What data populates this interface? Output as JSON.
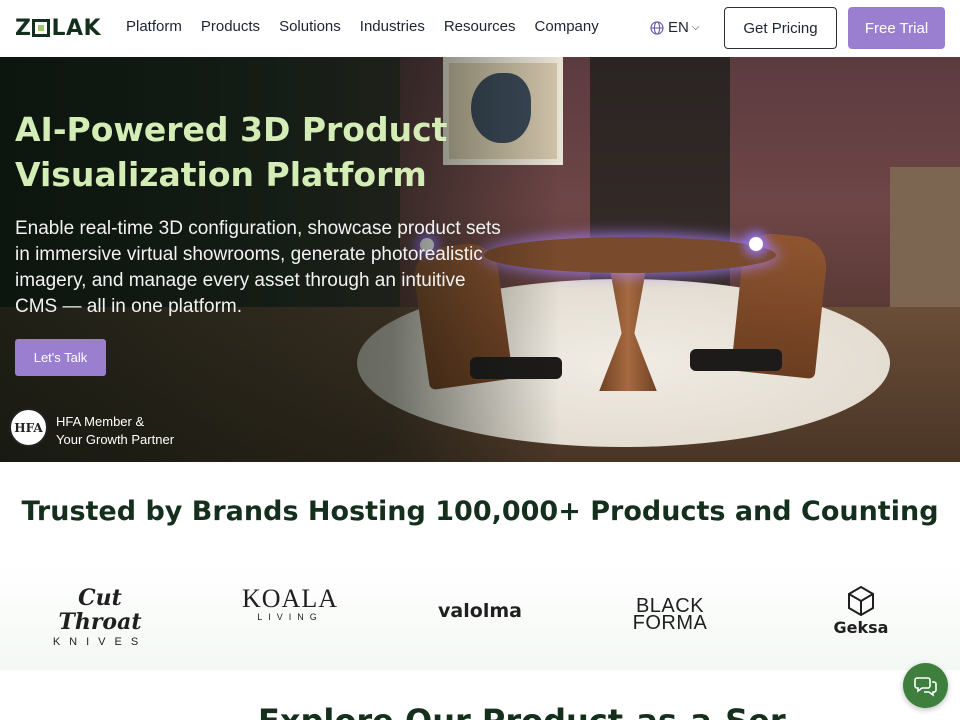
{
  "header": {
    "logo_text": "ZOLAK",
    "nav": [
      "Platform",
      "Products",
      "Solutions",
      "Industries",
      "Resources",
      "Company"
    ],
    "language": "EN",
    "pricing_label": "Get Pricing",
    "trial_label": "Free Trial"
  },
  "hero": {
    "title": "AI-Powered 3D Product Visualization Platform",
    "description": "Enable real-time 3D configuration, showcase product sets in immersive virtual showrooms, generate photorealistic imagery, and manage every asset through an intuitive CMS — all in one platform.",
    "cta_label": "Let's Talk",
    "badge_text": "HFA",
    "member_line1": "HFA Member &",
    "member_line2": "Your Growth Partner"
  },
  "trusted": {
    "title": "Trusted by Brands Hosting 100,000+ Products and Counting",
    "brands": {
      "cut_throat": {
        "line1": "Cut Throat",
        "line2": "KNIVES"
      },
      "koala": {
        "line1": "KOALA",
        "line2": "LIVING"
      },
      "valolma": "valolma",
      "black_forma": {
        "line1": "BLACK",
        "line2": "FORMA"
      },
      "geksa": "Geksa"
    }
  },
  "next_section": {
    "title": "Explore Our Product-as-a-Ser"
  },
  "colors": {
    "accent_purple": "#9a7fd0",
    "hero_title_green": "#d4ecb5",
    "dark_green": "#14301c",
    "chat_green": "#3f7f3d"
  },
  "icons": {
    "language": "globe-icon",
    "chat": "chat-bubbles-icon"
  }
}
